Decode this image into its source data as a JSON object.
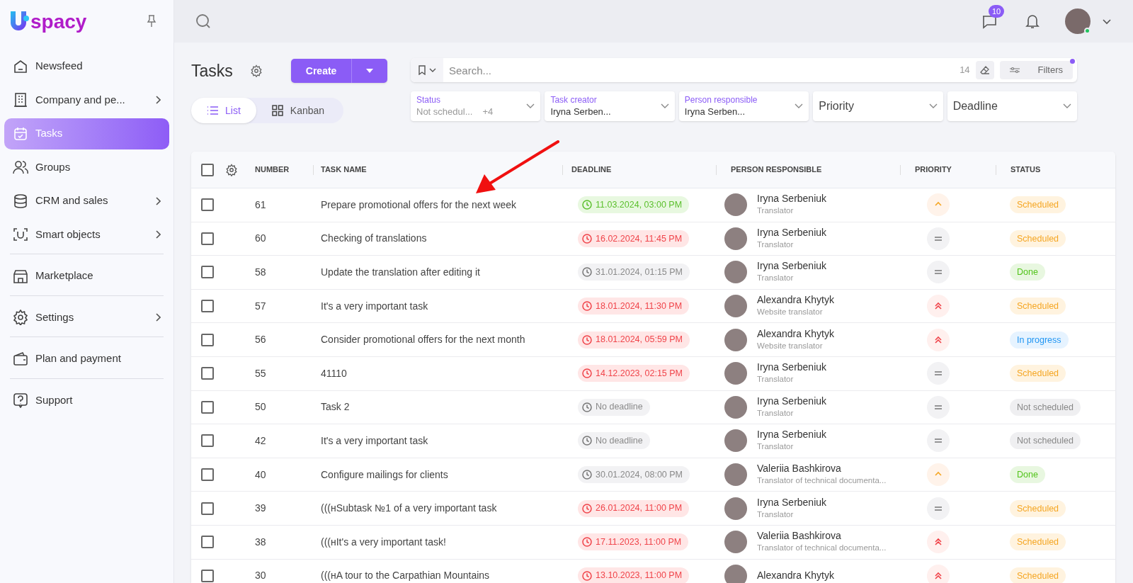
{
  "sidebar": {
    "logo": "spacy",
    "sections": [
      [
        {
          "label": "Newsfeed",
          "selected": false,
          "has_submenu": false
        },
        {
          "label": "Company and pe...",
          "selected": false,
          "has_submenu": true
        },
        {
          "label": "Tasks",
          "selected": true,
          "has_submenu": false
        },
        {
          "label": "Groups",
          "selected": false,
          "has_submenu": false
        },
        {
          "label": "CRM and sales",
          "selected": false,
          "has_submenu": true
        },
        {
          "label": "Smart objects",
          "selected": false,
          "has_submenu": true
        }
      ],
      [
        {
          "label": "Marketplace",
          "selected": false,
          "has_submenu": false
        }
      ],
      [
        {
          "label": "Settings",
          "selected": false,
          "has_submenu": true
        }
      ],
      [
        {
          "label": "Plan and payment",
          "selected": false,
          "has_submenu": false
        }
      ],
      [
        {
          "label": "Support",
          "selected": false,
          "has_submenu": false
        }
      ]
    ]
  },
  "topbar": {
    "chat_badge": "10",
    "user_online": true
  },
  "page": {
    "title": "Tasks",
    "create_button": "Create",
    "views": [
      {
        "label": "List",
        "selected": true
      },
      {
        "label": "Kanban",
        "selected": false
      }
    ],
    "search": {
      "placeholder": "Search...",
      "count": "14",
      "filters_button": "Filters",
      "filters_active": true
    },
    "filters": [
      {
        "label": "Status",
        "value": "Not schedul...",
        "extra": "+4"
      },
      {
        "label": "Task creator",
        "value": "Iryna Serben..."
      },
      {
        "label": "Person responsible",
        "value": "Iryna Serben..."
      },
      {
        "placeholder": "Priority"
      },
      {
        "placeholder": "Deadline"
      }
    ]
  },
  "table": {
    "columns": [
      "NUMBER",
      "TASK NAME",
      "DEADLINE",
      "PERSON RESPONSIBLE",
      "PRIORITY",
      "STATUS"
    ],
    "all_checked": false,
    "rows": [
      {
        "checked": false,
        "number": "61",
        "name": "Prepare promotional offers for the next week",
        "deadline": {
          "text": "11.03.2024, 03:00 PM",
          "kind": "upcoming"
        },
        "person": "Iryna Serbeniuk",
        "role": "Translator",
        "priority": {
          "kind": "high"
        },
        "status": {
          "text": "Scheduled",
          "kind": "scheduled"
        }
      },
      {
        "checked": false,
        "number": "60",
        "name": "Checking of translations",
        "deadline": {
          "text": "16.02.2024, 11:45 PM",
          "kind": "overdue"
        },
        "person": "Iryna Serbeniuk",
        "role": "Translator",
        "priority": {
          "kind": "normal"
        },
        "status": {
          "text": "Scheduled",
          "kind": "scheduled"
        }
      },
      {
        "checked": false,
        "number": "58",
        "name": "Update the translation after editing it",
        "deadline": {
          "text": "31.01.2024, 01:15 PM",
          "kind": "closed"
        },
        "person": "Iryna Serbeniuk",
        "role": "Translator",
        "priority": {
          "kind": "normal"
        },
        "status": {
          "text": "Done",
          "kind": "done"
        }
      },
      {
        "checked": false,
        "number": "57",
        "name": "It's a very important task",
        "deadline": {
          "text": "18.01.2024, 11:30 PM",
          "kind": "overdue"
        },
        "person": "Alexandra Khytyk",
        "role": "Website translator",
        "priority": {
          "kind": "urgent"
        },
        "status": {
          "text": "Scheduled",
          "kind": "scheduled"
        }
      },
      {
        "checked": false,
        "number": "56",
        "name": "Consider promotional offers for the next month",
        "deadline": {
          "text": "18.01.2024, 05:59 PM",
          "kind": "overdue"
        },
        "person": "Alexandra Khytyk",
        "role": "Website translator",
        "priority": {
          "kind": "urgent"
        },
        "status": {
          "text": "In progress",
          "kind": "in_progress"
        }
      },
      {
        "checked": false,
        "number": "55",
        "name": "41110",
        "deadline": {
          "text": "14.12.2023, 02:15 PM",
          "kind": "overdue"
        },
        "person": "Iryna Serbeniuk",
        "role": "Translator",
        "priority": {
          "kind": "normal"
        },
        "status": {
          "text": "Scheduled",
          "kind": "scheduled"
        }
      },
      {
        "checked": false,
        "number": "50",
        "name": "Task 2",
        "deadline": {
          "text": "No deadline",
          "kind": "closed"
        },
        "person": "Iryna Serbeniuk",
        "role": "Translator",
        "priority": {
          "kind": "normal"
        },
        "status": {
          "text": "Not scheduled",
          "kind": "not_scheduled"
        }
      },
      {
        "checked": false,
        "number": "42",
        "name": "It's a very important task",
        "deadline": {
          "text": "No deadline",
          "kind": "closed"
        },
        "person": "Iryna Serbeniuk",
        "role": "Translator",
        "priority": {
          "kind": "normal"
        },
        "status": {
          "text": "Not scheduled",
          "kind": "not_scheduled"
        }
      },
      {
        "checked": false,
        "number": "40",
        "name": "Configure mailings for clients",
        "deadline": {
          "text": "30.01.2024, 08:00 PM",
          "kind": "closed"
        },
        "person": "Valeriia Bashkirova",
        "role": "Translator of technical documenta...",
        "priority": {
          "kind": "high"
        },
        "status": {
          "text": "Done",
          "kind": "done"
        }
      },
      {
        "checked": false,
        "number": "39",
        "name": "(((нSubtask №1 of a very important task",
        "deadline": {
          "text": "26.01.2024, 11:00 PM",
          "kind": "overdue"
        },
        "person": "Iryna Serbeniuk",
        "role": "Translator",
        "priority": {
          "kind": "normal"
        },
        "status": {
          "text": "Scheduled",
          "kind": "scheduled"
        }
      },
      {
        "checked": false,
        "number": "38",
        "name": "(((нIt's a very important task!",
        "deadline": {
          "text": "17.11.2023, 11:00 PM",
          "kind": "overdue"
        },
        "person": "Valeriia Bashkirova",
        "role": "Translator of technical documenta...",
        "priority": {
          "kind": "urgent"
        },
        "status": {
          "text": "Scheduled",
          "kind": "scheduled"
        }
      },
      {
        "checked": false,
        "number": "30",
        "name": "(((нA tour to the Carpathian Mountains",
        "deadline": {
          "text": "13.10.2023, 11:00 PM",
          "kind": "overdue"
        },
        "person": "Alexandra Khytyk",
        "priority": {
          "kind": "urgent"
        },
        "status": {
          "text": "Scheduled",
          "kind": "scheduled"
        }
      }
    ]
  }
}
